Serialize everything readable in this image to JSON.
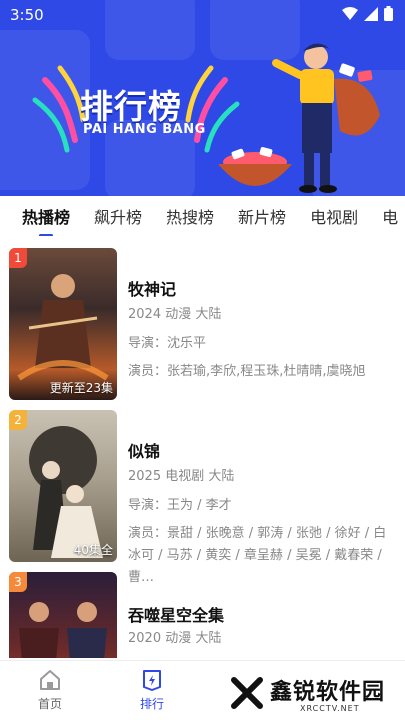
{
  "status": {
    "time": "3:50"
  },
  "banner": {
    "title": "排行榜",
    "subtitle": "PAI HANG BANG"
  },
  "tabs": [
    {
      "label": "热播榜",
      "active": true
    },
    {
      "label": "飙升榜",
      "active": false
    },
    {
      "label": "热搜榜",
      "active": false
    },
    {
      "label": "新片榜",
      "active": false
    },
    {
      "label": "电视剧",
      "active": false
    },
    {
      "label": "电",
      "active": false
    }
  ],
  "items": [
    {
      "rank": "1",
      "title": "牧神记",
      "info": "2024 动漫 大陆",
      "director": "导演：沈乐平",
      "cast": "演员：张若瑜,李欣,程玉珠,杜晴晴,虞晓旭",
      "poster_note": "更新至23集",
      "rank_color": "#f04a3a"
    },
    {
      "rank": "2",
      "title": "似锦",
      "info": "2025 电视剧 大陆",
      "director": "导演：王为 / 李才",
      "cast": "演员：景甜 / 张晚意 / 郭涛 / 张弛 / 徐好 / 白冰可 / 马苏 / 黄奕 / 章呈赫 / 吴冕 / 戴春荣 / 曹…",
      "poster_note": "40集全",
      "rank_color": "#f5b23a"
    },
    {
      "rank": "3",
      "title": "吞噬星空全集",
      "info": "2020 动漫 大陆",
      "director": "",
      "cast": "",
      "poster_note": "",
      "rank_color": "#f58a3a"
    }
  ],
  "bottom_nav": [
    {
      "label": "首页",
      "icon": "home-icon",
      "active": false
    },
    {
      "label": "排行",
      "icon": "rank-icon",
      "active": true
    }
  ],
  "watermark": {
    "text": "鑫锐软件园",
    "sub": "XRCCTV.NET"
  },
  "colors": {
    "accent": "#2f49e6",
    "banner_bg": "#2f49e6"
  }
}
